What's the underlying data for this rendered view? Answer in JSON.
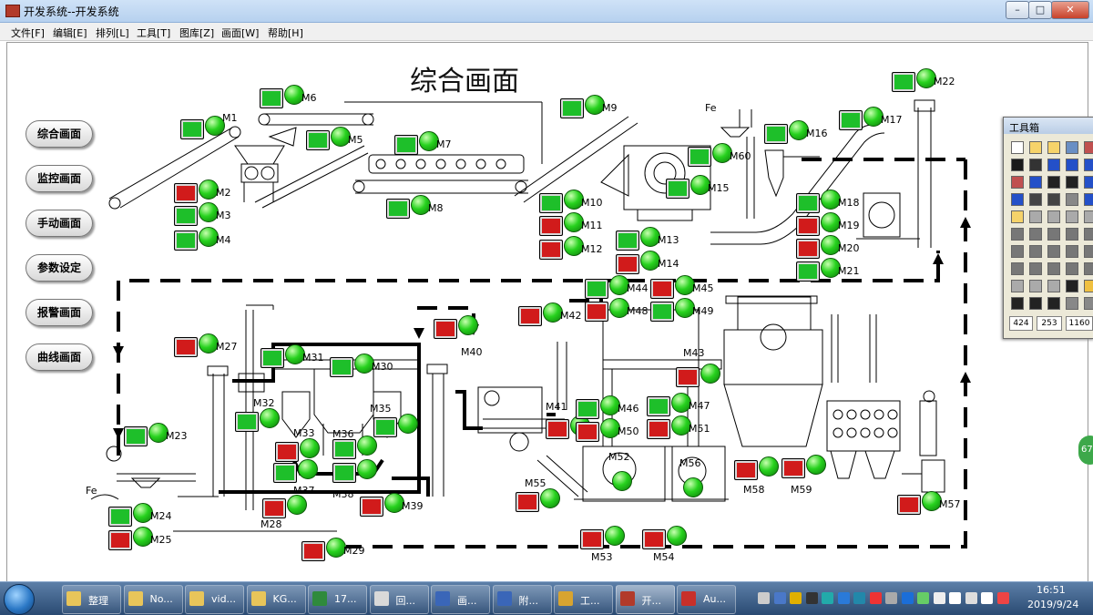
{
  "window": {
    "title": "开发系统--开发系统",
    "controls": [
      "–",
      "□",
      "✕"
    ]
  },
  "menu": [
    "文件[F]",
    "编辑[E]",
    "排列[L]",
    "工具[T]",
    "图库[Z]",
    "画面[W]",
    "帮助[H]"
  ],
  "nav_buttons": [
    "综合画面",
    "监控画面",
    "手动画面",
    "参数设定",
    "报警画面",
    "曲线画面"
  ],
  "page_title": "综合画面",
  "fe_labels": [
    "Fe",
    "Fe"
  ],
  "motors": [
    {
      "id": "M1",
      "sq": "green"
    },
    {
      "id": "M2",
      "sq": "red"
    },
    {
      "id": "M3",
      "sq": "green"
    },
    {
      "id": "M4",
      "sq": "green"
    },
    {
      "id": "M5",
      "sq": "green"
    },
    {
      "id": "M6",
      "sq": "green"
    },
    {
      "id": "M7",
      "sq": "green"
    },
    {
      "id": "M8",
      "sq": "green"
    },
    {
      "id": "M9",
      "sq": "green"
    },
    {
      "id": "M10",
      "sq": "green"
    },
    {
      "id": "M11",
      "sq": "red"
    },
    {
      "id": "M12",
      "sq": "red"
    },
    {
      "id": "M13",
      "sq": "green"
    },
    {
      "id": "M14",
      "sq": "red"
    },
    {
      "id": "M15",
      "sq": "green"
    },
    {
      "id": "M16",
      "sq": "green"
    },
    {
      "id": "M17",
      "sq": "green"
    },
    {
      "id": "M18",
      "sq": "green"
    },
    {
      "id": "M19",
      "sq": "red"
    },
    {
      "id": "M20",
      "sq": "red"
    },
    {
      "id": "M21",
      "sq": "green"
    },
    {
      "id": "M22",
      "sq": "green"
    },
    {
      "id": "M23",
      "sq": "green"
    },
    {
      "id": "M24",
      "sq": "green"
    },
    {
      "id": "M25",
      "sq": "red"
    },
    {
      "id": "M27",
      "sq": "red"
    },
    {
      "id": "M28",
      "sq": "red"
    },
    {
      "id": "M29",
      "sq": "red"
    },
    {
      "id": "M30",
      "sq": "green"
    },
    {
      "id": "M31",
      "sq": "green"
    },
    {
      "id": "M32",
      "sq": "green"
    },
    {
      "id": "M33",
      "sq": "red"
    },
    {
      "id": "M35",
      "sq": "green"
    },
    {
      "id": "M36",
      "sq": "green"
    },
    {
      "id": "M37",
      "sq": "green"
    },
    {
      "id": "M38",
      "sq": "green"
    },
    {
      "id": "M39",
      "sq": "red"
    },
    {
      "id": "M40",
      "sq": "red"
    },
    {
      "id": "M41",
      "sq": "red"
    },
    {
      "id": "M42",
      "sq": "red"
    },
    {
      "id": "M43",
      "sq": "red"
    },
    {
      "id": "M44",
      "sq": "green"
    },
    {
      "id": "M45",
      "sq": "red"
    },
    {
      "id": "M46",
      "sq": "green"
    },
    {
      "id": "M47",
      "sq": "green"
    },
    {
      "id": "M48",
      "sq": "red"
    },
    {
      "id": "M49",
      "sq": "green"
    },
    {
      "id": "M50",
      "sq": "red"
    },
    {
      "id": "M51",
      "sq": "red"
    },
    {
      "id": "M52",
      "sq": "none"
    },
    {
      "id": "M53",
      "sq": "red"
    },
    {
      "id": "M54",
      "sq": "red"
    },
    {
      "id": "M55",
      "sq": "red"
    },
    {
      "id": "M56",
      "sq": "none"
    },
    {
      "id": "M57",
      "sq": "red"
    },
    {
      "id": "M58",
      "sq": "red"
    },
    {
      "id": "M59",
      "sq": "red"
    },
    {
      "id": "M60",
      "sq": "green"
    }
  ],
  "toolbox": {
    "title": "工具箱",
    "fields": [
      "424",
      "253",
      "1160"
    ]
  },
  "side_tab_text": "67",
  "taskbar": {
    "items": [
      {
        "label": "整理",
        "icon": "folder-icon"
      },
      {
        "label": "No...",
        "icon": "folder-icon"
      },
      {
        "label": "vid...",
        "icon": "folder-icon"
      },
      {
        "label": "KG...",
        "icon": "folder-icon"
      },
      {
        "label": "17...",
        "icon": "excel-icon"
      },
      {
        "label": "回...",
        "icon": "paint-icon"
      },
      {
        "label": "画...",
        "icon": "word-icon"
      },
      {
        "label": "附...",
        "icon": "word-icon"
      },
      {
        "label": "工...",
        "icon": "tool-icon"
      },
      {
        "label": "开...",
        "icon": "app-icon"
      },
      {
        "label": "Au...",
        "icon": "autocad-icon"
      }
    ],
    "clock_time": "16:51",
    "clock_date": "2019/9/24"
  }
}
